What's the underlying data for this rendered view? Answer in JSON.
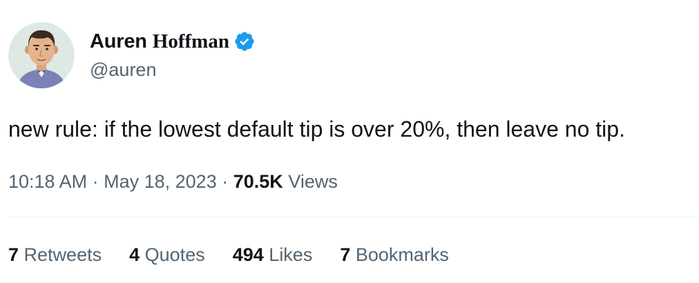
{
  "author": {
    "name_first": "Auren",
    "name_last": "Hoffman",
    "handle": "@auren",
    "verified": true,
    "verified_icon": "verified-badge-icon",
    "avatar": "avatar-illustration"
  },
  "tweet": {
    "text": "new rule: if the lowest default tip is over 20%, then leave no tip."
  },
  "meta": {
    "time": "10:18 AM",
    "separator": "·",
    "date": "May 18, 2023",
    "views_count": "70.5K",
    "views_label": "Views"
  },
  "stats": [
    {
      "count": "7",
      "label": "Retweets"
    },
    {
      "count": "4",
      "label": "Quotes"
    },
    {
      "count": "494",
      "label": "Likes"
    },
    {
      "count": "7",
      "label": "Bookmarks"
    }
  ],
  "colors": {
    "text": "#0f1419",
    "secondary": "#536471",
    "verified_blue": "#1d9bf0",
    "avatar_bg": "#dfe9e3",
    "divider": "#eff3f4"
  }
}
